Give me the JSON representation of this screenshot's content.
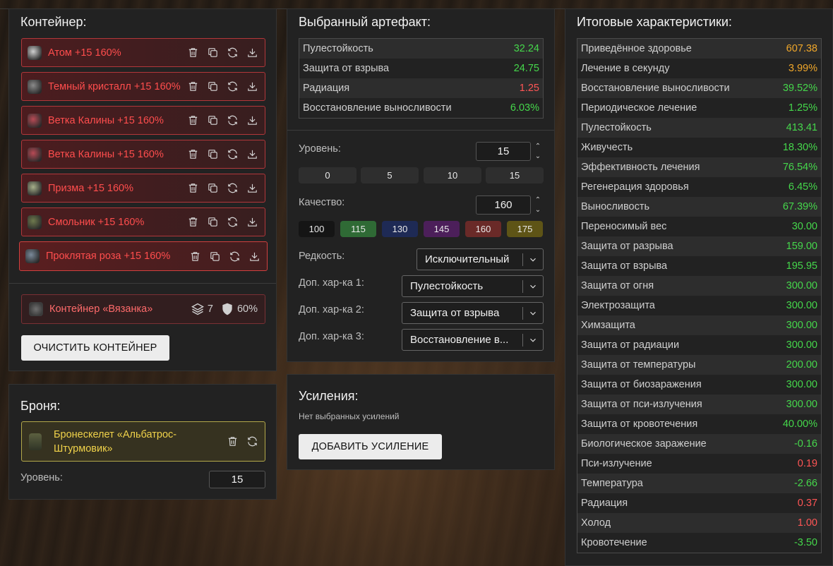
{
  "container": {
    "title": "Контейнер:",
    "items": [
      {
        "name": "Атом +15 160%",
        "icon": "atom-icon",
        "color": "#cfcfcf"
      },
      {
        "name": "Темный кристалл +15 160%",
        "icon": "dark-crystal-icon",
        "color": "#8a8a8a"
      },
      {
        "name": "Ветка Калины +15 160%",
        "icon": "viburnum-branch-icon",
        "color": "#b84a55"
      },
      {
        "name": "Ветка Калины +15 160%",
        "icon": "viburnum-branch-icon",
        "color": "#b84a55"
      },
      {
        "name": "Призма +15 160%",
        "icon": "prism-icon",
        "color": "#a7b08a"
      },
      {
        "name": "Смольник +15 160%",
        "icon": "smolnik-icon",
        "color": "#6f7a4e"
      },
      {
        "name": "Проклятая роза +15 160%",
        "icon": "cursed-rose-icon",
        "color": "#7a8a9a"
      }
    ],
    "card": {
      "name": "Контейнер «Вязанка»",
      "capacity": "7",
      "protection": "60%"
    },
    "clear_button": "ОЧИСТИТЬ КОНТЕЙНЕР"
  },
  "armor": {
    "title": "Броня:",
    "name": "Бронескелет «Альбатрос-Штурмовик»",
    "level_label": "Уровень:",
    "level_value": "15"
  },
  "artifact": {
    "title": "Выбранный артефакт:",
    "stats": [
      {
        "label": "Пулестойкость",
        "value": "32.24",
        "tone": "green"
      },
      {
        "label": "Защита от взрыва",
        "value": "24.75",
        "tone": "green"
      },
      {
        "label": "Радиация",
        "value": "1.25",
        "tone": "red"
      },
      {
        "label": "Восстановление выносливости",
        "value": "6.03%",
        "tone": "green"
      }
    ],
    "level_label": "Уровень:",
    "level_value": "15",
    "level_presets": [
      "0",
      "5",
      "10",
      "15"
    ],
    "quality_label": "Качество:",
    "quality_value": "160",
    "quality_presets": [
      {
        "label": "100",
        "color": "#151515"
      },
      {
        "label": "115",
        "color": "#2f6a35"
      },
      {
        "label": "130",
        "color": "#1e2a55"
      },
      {
        "label": "145",
        "color": "#4c1f5a"
      },
      {
        "label": "160",
        "color": "#6a2a28"
      },
      {
        "label": "175",
        "color": "#5e5416"
      }
    ],
    "rarity_label": "Редкость:",
    "rarity_value": "Исключительный",
    "extra1_label": "Доп. хар-ка 1:",
    "extra1_value": "Пулестойкость",
    "extra2_label": "Доп. хар-ка 2:",
    "extra2_value": "Защита от взрыва",
    "extra3_label": "Доп. хар-ка 3:",
    "extra3_value": "Восстановление в..."
  },
  "boosts": {
    "title": "Усиления:",
    "empty_text": "Нет выбранных усилений",
    "add_button": "ДОБАВИТЬ УСИЛЕНИЕ"
  },
  "totals": {
    "title": "Итоговые характеристики:",
    "stats": [
      {
        "label": "Приведённое здоровье",
        "value": "607.38",
        "tone": "orange"
      },
      {
        "label": "Лечение в секунду",
        "value": "3.99%",
        "tone": "orange"
      },
      {
        "label": "Восстановление выносливости",
        "value": "39.52%",
        "tone": "green"
      },
      {
        "label": "Периодическое лечение",
        "value": "1.25%",
        "tone": "green"
      },
      {
        "label": "Пулестойкость",
        "value": "413.41",
        "tone": "green"
      },
      {
        "label": "Живучесть",
        "value": "18.30%",
        "tone": "green"
      },
      {
        "label": "Эффективность лечения",
        "value": "76.54%",
        "tone": "green"
      },
      {
        "label": "Регенерация здоровья",
        "value": "6.45%",
        "tone": "green"
      },
      {
        "label": "Выносливость",
        "value": "67.39%",
        "tone": "green"
      },
      {
        "label": "Переносимый вес",
        "value": "30.00",
        "tone": "green"
      },
      {
        "label": "Защита от разрыва",
        "value": "159.00",
        "tone": "green"
      },
      {
        "label": "Защита от взрыва",
        "value": "195.95",
        "tone": "green"
      },
      {
        "label": "Защита от огня",
        "value": "300.00",
        "tone": "green"
      },
      {
        "label": "Электрозащита",
        "value": "300.00",
        "tone": "green"
      },
      {
        "label": "Химзащита",
        "value": "300.00",
        "tone": "green"
      },
      {
        "label": "Защита от радиации",
        "value": "300.00",
        "tone": "green"
      },
      {
        "label": "Защита от температуры",
        "value": "200.00",
        "tone": "green"
      },
      {
        "label": "Защита от биозаражения",
        "value": "300.00",
        "tone": "green"
      },
      {
        "label": "Защита от пси-излучения",
        "value": "300.00",
        "tone": "green"
      },
      {
        "label": "Защита от кровотечения",
        "value": "40.00%",
        "tone": "green"
      },
      {
        "label": "Биологическое заражение",
        "value": "-0.16",
        "tone": "green"
      },
      {
        "label": "Пси-излучение",
        "value": "0.19",
        "tone": "red"
      },
      {
        "label": "Температура",
        "value": "-2.66",
        "tone": "green"
      },
      {
        "label": "Радиация",
        "value": "0.37",
        "tone": "red"
      },
      {
        "label": "Холод",
        "value": "1.00",
        "tone": "red"
      },
      {
        "label": "Кровотечение",
        "value": "-3.50",
        "tone": "green"
      }
    ]
  }
}
